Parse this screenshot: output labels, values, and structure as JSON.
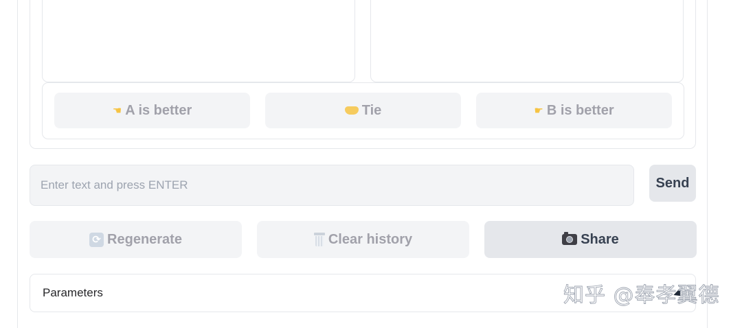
{
  "vote": {
    "a_better": {
      "label": "A is better",
      "icon": "backhand-index-pointing-left-icon"
    },
    "tie": {
      "label": "Tie",
      "icon": "handshake-icon"
    },
    "b_better": {
      "label": "B is better",
      "icon": "backhand-index-pointing-right-icon"
    }
  },
  "input": {
    "placeholder": "Enter text and press ENTER",
    "value": ""
  },
  "send": {
    "label": "Send"
  },
  "actions": {
    "regenerate": {
      "label": "Regenerate",
      "icon": "regenerate-icon"
    },
    "clear_history": {
      "label": "Clear history",
      "icon": "wastebasket-icon"
    },
    "share": {
      "label": "Share",
      "icon": "camera-icon"
    }
  },
  "parameters": {
    "label": "Parameters"
  },
  "watermark": {
    "text": "知乎 @奉孝翼德"
  },
  "colors": {
    "disabled_bg": "#f3f4f6",
    "disabled_text": "#a1a1aa",
    "active_bg": "#e5e7eb",
    "active_text": "#374151",
    "border": "#e5e7eb",
    "emoji_yellow": "#f6c343"
  }
}
